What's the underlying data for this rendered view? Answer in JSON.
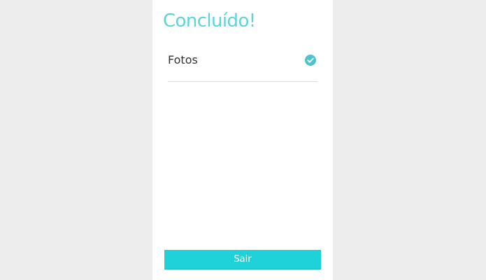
{
  "screen": {
    "title": "Concluído!",
    "items": [
      {
        "label": "Fotos",
        "status_icon": "check-circle-icon"
      }
    ],
    "exit_button_label": "Sair"
  },
  "colors": {
    "background": "#ededed",
    "panel": "#ffffff",
    "accent": "#1fd1d9",
    "title": "#5fd3da",
    "check": "#4fc3cc",
    "divider": "#d9d9d9"
  }
}
